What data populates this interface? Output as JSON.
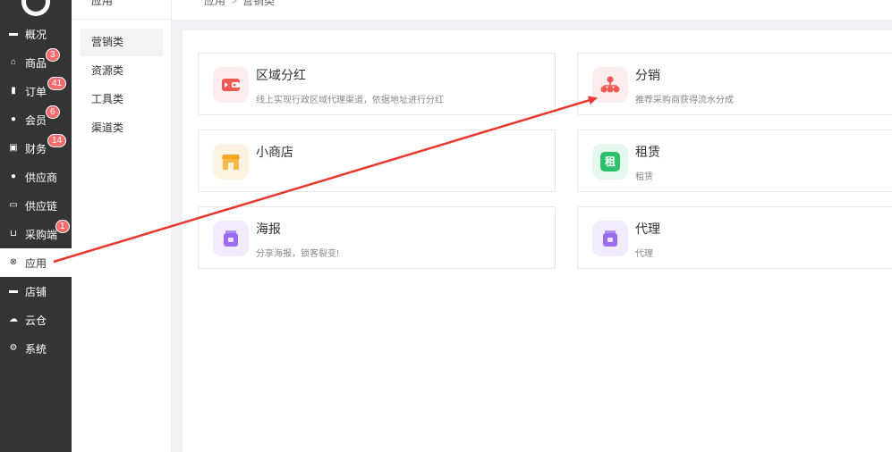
{
  "sidebar": {
    "items": [
      {
        "label": "概况",
        "icon": "monitor-icon",
        "glyph": "▬",
        "badge": ""
      },
      {
        "label": "商品",
        "icon": "bag-icon",
        "glyph": "⌂",
        "badge": "3"
      },
      {
        "label": "订单",
        "icon": "clipboard-icon",
        "glyph": "▮",
        "badge": "41"
      },
      {
        "label": "会员",
        "icon": "user-icon",
        "glyph": "●",
        "badge": "6"
      },
      {
        "label": "财务",
        "icon": "wallet-icon",
        "glyph": "▣",
        "badge": "14"
      },
      {
        "label": "供应商",
        "icon": "supplier-icon",
        "glyph": "●",
        "badge": ""
      },
      {
        "label": "供应链",
        "icon": "truck-icon",
        "glyph": "▭",
        "badge": ""
      },
      {
        "label": "采购端",
        "icon": "cart-icon",
        "glyph": "⊔",
        "badge": "1"
      },
      {
        "label": "应用",
        "icon": "apps-icon",
        "glyph": "⊗",
        "badge": ""
      },
      {
        "label": "店铺",
        "icon": "store-icon",
        "glyph": "▬",
        "badge": ""
      },
      {
        "label": "云仓",
        "icon": "cloud-icon",
        "glyph": "☁",
        "badge": ""
      },
      {
        "label": "系统",
        "icon": "gear-icon",
        "glyph": "⚙",
        "badge": ""
      }
    ]
  },
  "subnav": {
    "title": "应用",
    "items": [
      "营销类",
      "资源类",
      "工具类",
      "渠道类"
    ]
  },
  "breadcrumb": {
    "root": "应用",
    "sep": ">",
    "current": "营销类"
  },
  "cards": [
    {
      "title": "区域分红",
      "desc": "线上实现行政区域代理渠道，依据地址进行分红",
      "icon": "wallet-icon"
    },
    {
      "title": "分销",
      "desc": "推荐采购商获得流水分成",
      "icon": "network-icon"
    },
    {
      "title": "小商店",
      "desc": "",
      "icon": "shop-icon"
    },
    {
      "title": "租赁",
      "desc": "租赁",
      "icon": "rent-icon",
      "icon_text": "租"
    },
    {
      "title": "海报",
      "desc": "分享海报，锁客裂变!",
      "icon": "jar-icon"
    },
    {
      "title": "代理",
      "desc": "代理",
      "icon": "jar-icon"
    }
  ],
  "colors": {
    "sidebar_bg": "#333436",
    "badge": "#f56c6c",
    "arrow": "#e8382f",
    "red_icon": "#ee5a52",
    "orange_icon": "#f5a623",
    "green_icon": "#2bc06a",
    "purple_icon": "#9b6cf0"
  }
}
